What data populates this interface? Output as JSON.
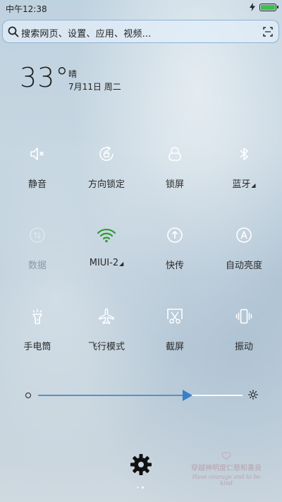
{
  "status_bar": {
    "time": "中午12:38",
    "battery_level": 1.0,
    "battery_color": "#3ec14a"
  },
  "search": {
    "placeholder": "搜索网页、设置、应用、视频..."
  },
  "weather": {
    "temperature": "33°",
    "condition": "晴",
    "date": "7月11日 周二"
  },
  "tiles": [
    {
      "label": "静音",
      "icon": "mute-icon",
      "active": false
    },
    {
      "label": "方向锁定",
      "icon": "rotation-lock-icon",
      "active": false
    },
    {
      "label": "锁屏",
      "icon": "lock-screen-icon",
      "active": false
    },
    {
      "label": "蓝牙",
      "icon": "bluetooth-icon",
      "active": false
    },
    {
      "label": "数据",
      "icon": "mobile-data-icon",
      "active": false
    },
    {
      "label": "MIUI-2",
      "icon": "wifi-icon",
      "active": true
    },
    {
      "label": "快传",
      "icon": "quick-transfer-icon",
      "active": false
    },
    {
      "label": "自动亮度",
      "icon": "auto-brightness-icon",
      "active": false
    },
    {
      "label": "手电筒",
      "icon": "flashlight-icon",
      "active": false
    },
    {
      "label": "飞行模式",
      "icon": "airplane-icon",
      "active": false
    },
    {
      "label": "截屏",
      "icon": "screenshot-icon",
      "active": false
    },
    {
      "label": "振动",
      "icon": "vibrate-icon",
      "active": false
    }
  ],
  "brightness": {
    "level": 0.73
  },
  "pager": {
    "count": 2,
    "active_index": 1
  },
  "watermark": {
    "main": "穿越神明度仁慈和善良",
    "sub": "Have courage and to be kind"
  },
  "colors": {
    "accent": "#3a7fc7",
    "wifi_active": "#2f9a2f",
    "text": "#2a2a2a",
    "dim": "#8a99a8"
  }
}
